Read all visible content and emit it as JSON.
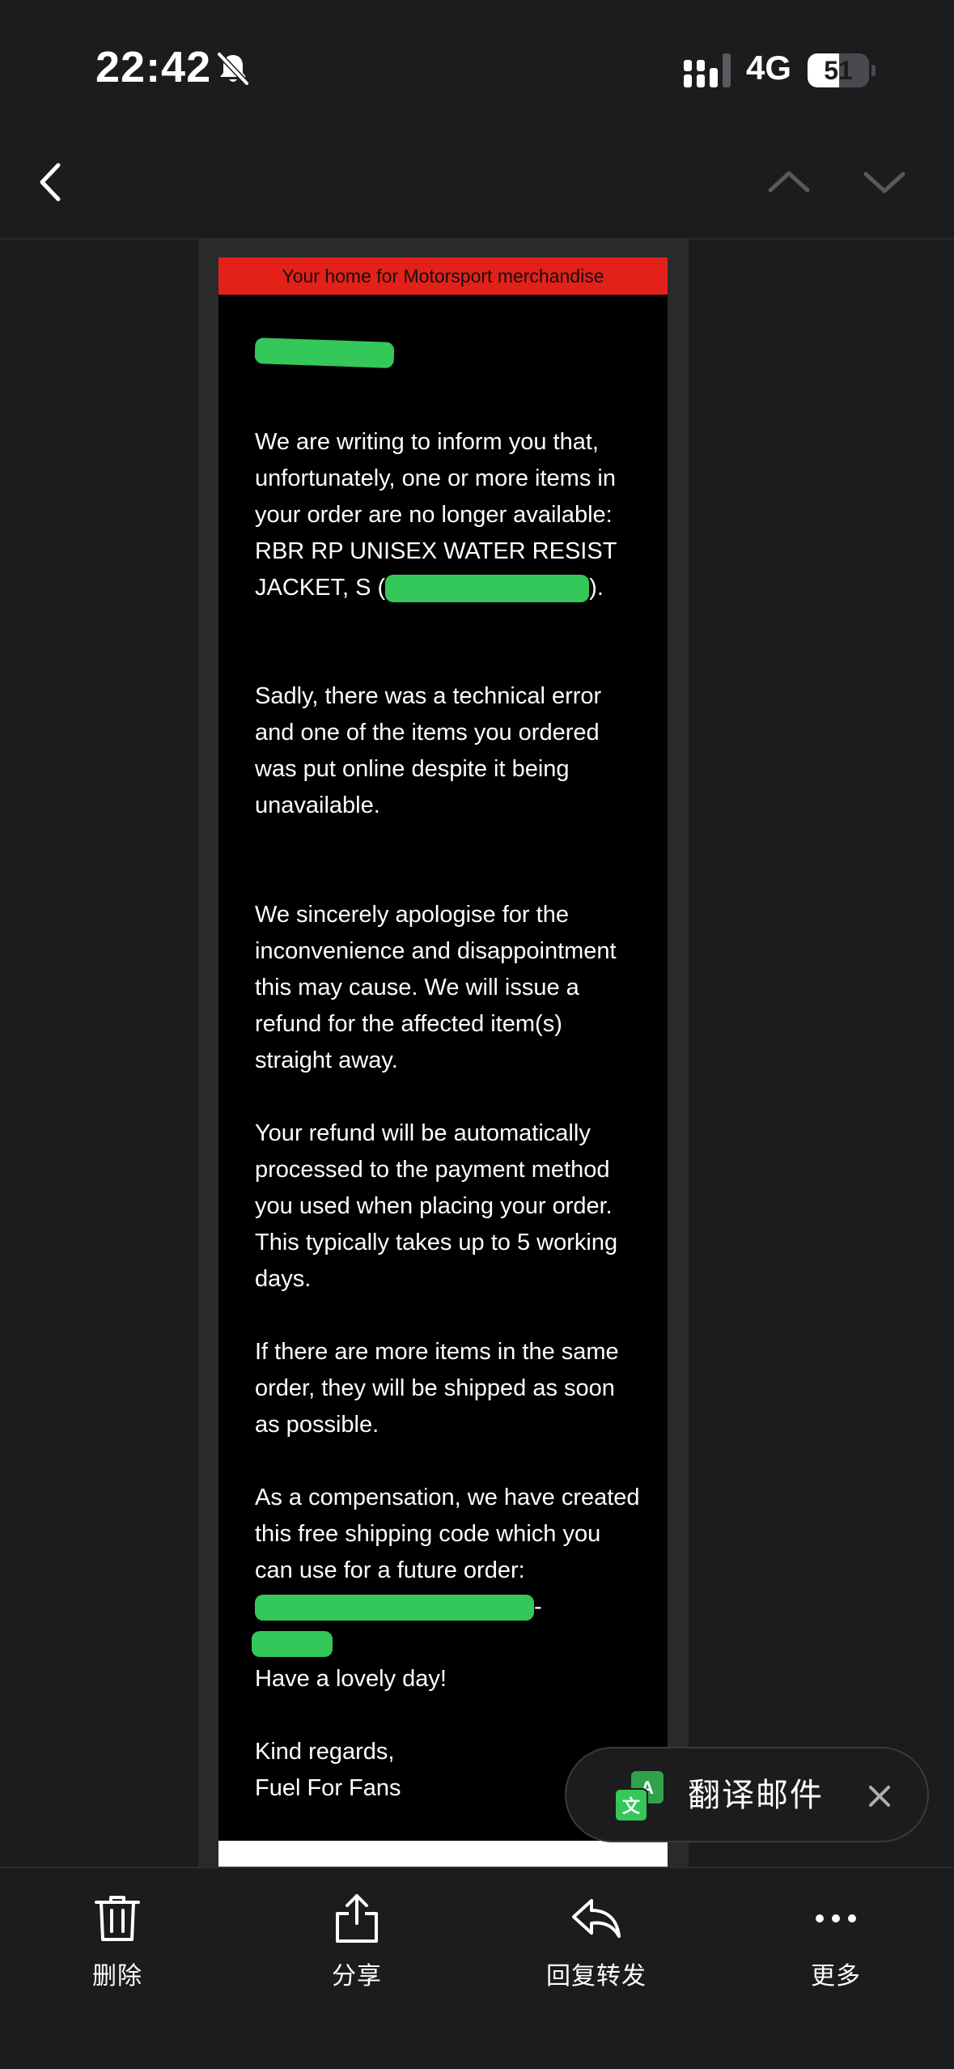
{
  "status_bar": {
    "time": "22:42",
    "network": "4G",
    "battery": "51",
    "battery_level": 0.51
  },
  "nav": {
    "back_icon": "chevron-left-icon",
    "prev_icon": "chevron-up-icon",
    "next_icon": "chevron-down-icon"
  },
  "email": {
    "banner": "Your home for Motorsport merchandise",
    "paragraph1_text": "We are writing to inform you that, unfortunately, one or more items in your order are no longer available: RBR RP UNISEX WATER RESIST JACKET, S",
    "paragraph1_open": "(",
    "paragraph1_close": ").",
    "paragraph2": "Sadly, there was a technical error and one of the items you ordered was put online despite it being unavailable.",
    "paragraph3": "We sincerely apologise for the inconvenience and disappointment this may cause. We will issue a refund for the affected item(s) straight away.",
    "paragraph4": "Your refund will be automatically processed to the payment method you used when placing your order. This typically takes up to 5 working days.",
    "paragraph5": "If there are more items in the same order, they will be shipped as soon as possible.",
    "paragraph6": "As a compensation, we have created this free shipping code which you can use for a future order:",
    "paragraph6_suffix": "-",
    "closing1": "Have a lovely day!",
    "closing2": "Kind regards,",
    "closing3": "Fuel For Fans"
  },
  "translate_popup": {
    "label": "翻译邮件",
    "icon": "translate-icon",
    "close_icon": "close-icon"
  },
  "toolbar": {
    "delete_label": "删除",
    "share_label": "分享",
    "reply_label": "回复转发",
    "more_label": "更多"
  },
  "colors": {
    "background": "#1c1c1e",
    "banner_red": "#e32119",
    "redaction_green": "#34c759"
  }
}
